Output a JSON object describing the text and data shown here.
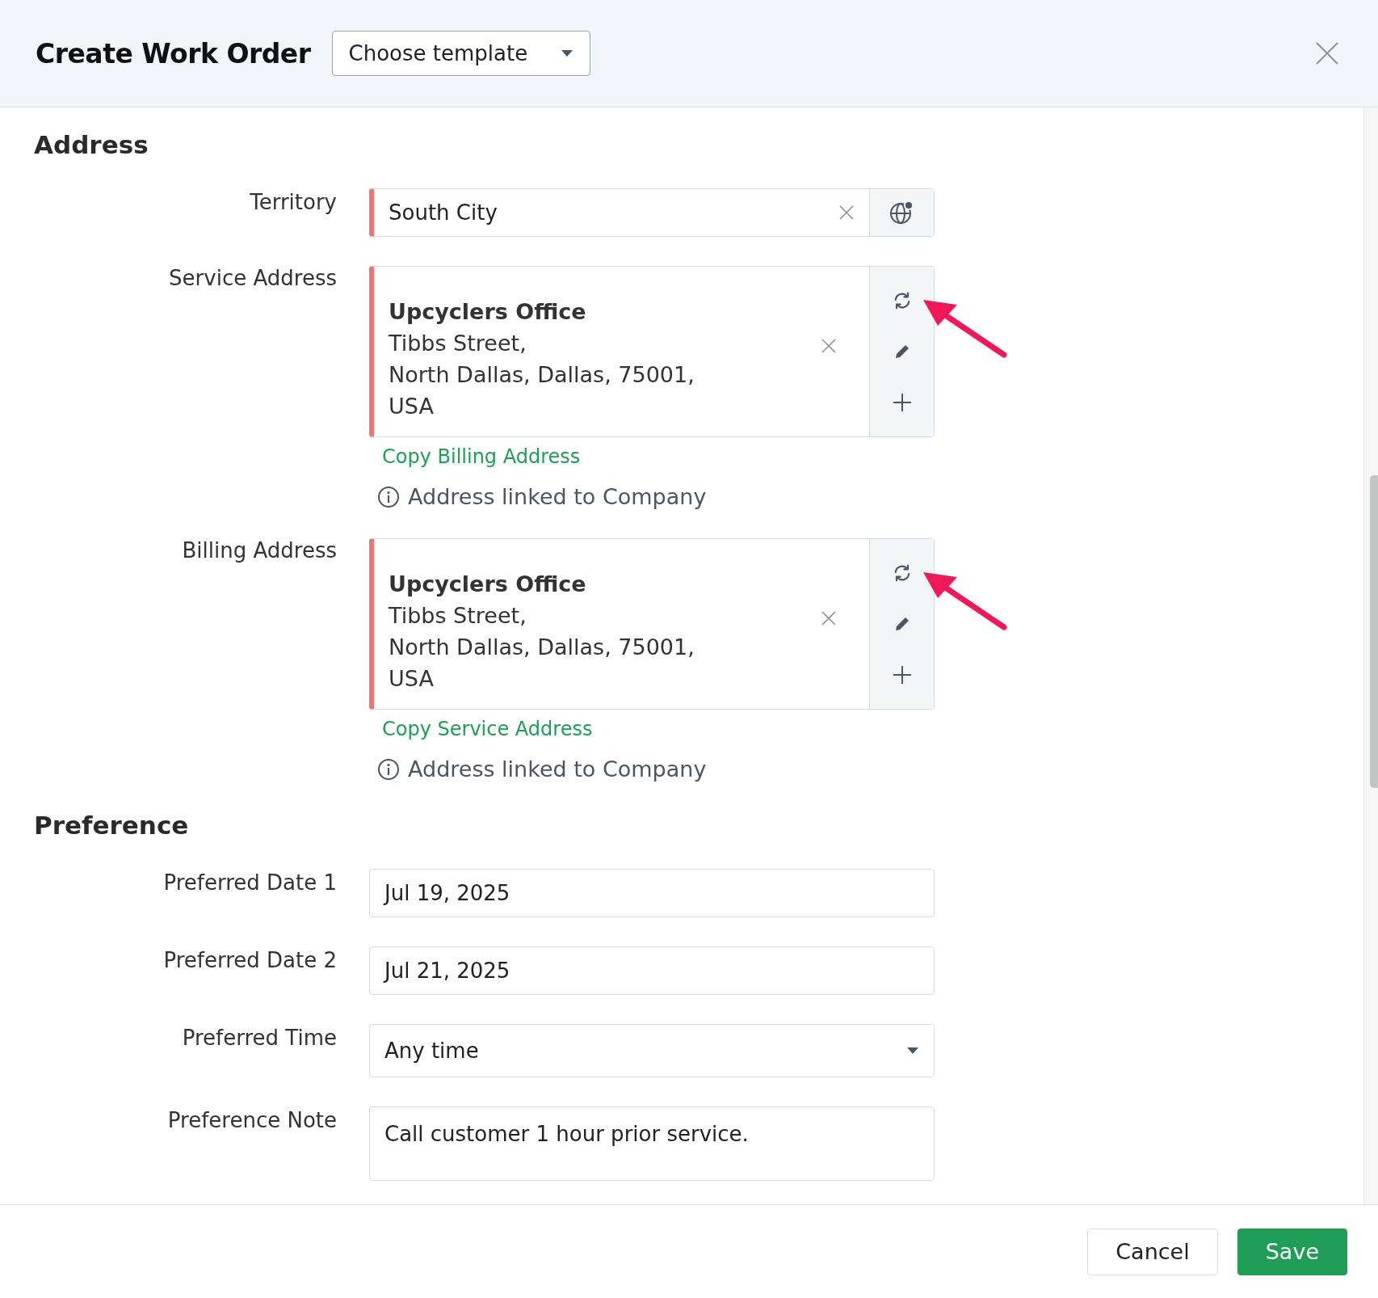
{
  "header": {
    "title": "Create Work Order",
    "template_select": {
      "value": "Choose template"
    }
  },
  "sections": [
    {
      "title": "Address",
      "fields": [
        {
          "kind": "lookup",
          "label": "Territory",
          "value": "South City",
          "required": true
        },
        {
          "kind": "address",
          "label": "Service Address",
          "required": true,
          "annotated": true,
          "name": "Upcyclers Office",
          "lines": [
            "Tibbs Street,",
            "North Dallas, Dallas, 75001,",
            "USA"
          ],
          "copy_link": "Copy Billing Address",
          "info": "Address linked to Company"
        },
        {
          "kind": "address",
          "label": "Billing Address",
          "required": true,
          "annotated": true,
          "name": "Upcyclers Office",
          "lines": [
            "Tibbs Street,",
            "North Dallas, Dallas, 75001,",
            "USA"
          ],
          "copy_link": "Copy Service Address",
          "info": "Address linked to Company"
        }
      ]
    },
    {
      "title": "Preference",
      "fields": [
        {
          "kind": "date",
          "label": "Preferred Date 1",
          "value": "Jul 19, 2025",
          "required": false
        },
        {
          "kind": "date",
          "label": "Preferred Date 2",
          "value": "Jul 21, 2025",
          "required": false
        },
        {
          "kind": "select",
          "label": "Preferred Time",
          "value": "Any time",
          "required": false
        },
        {
          "kind": "textarea",
          "label": "Preference Note",
          "value": "Call customer 1 hour prior service.",
          "required": false
        }
      ]
    }
  ],
  "footer": {
    "buttons": [
      {
        "label": "Cancel",
        "kind": "secondary"
      },
      {
        "label": "Save",
        "kind": "primary"
      }
    ]
  }
}
